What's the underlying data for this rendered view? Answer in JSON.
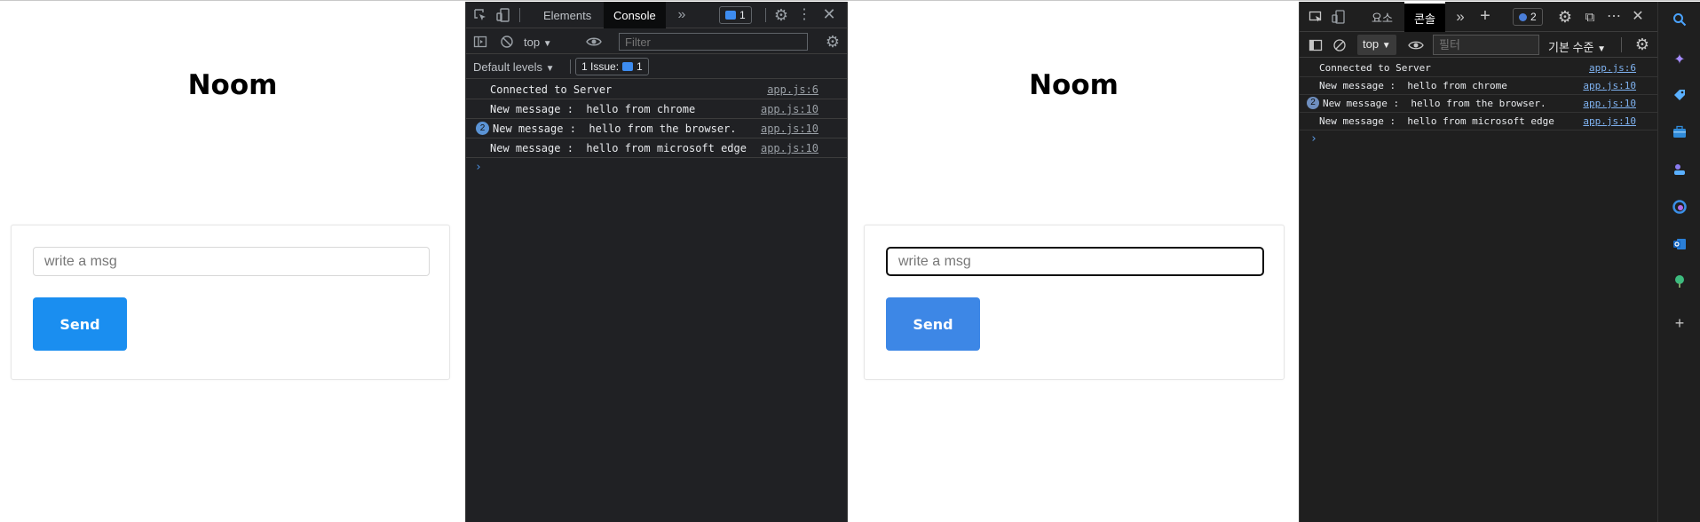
{
  "left_app": {
    "title": "Noom",
    "input_placeholder": "write a msg",
    "send_label": "Send",
    "send_color": "#1a8ef0"
  },
  "chrome_devtools": {
    "tabs": [
      "Elements",
      "Console"
    ],
    "active_tab": "Console",
    "messages_badge": "1",
    "context": "top",
    "filter_placeholder": "Filter",
    "levels": "Default levels",
    "issues": "1 Issue:",
    "issues_count": "1",
    "logs": [
      {
        "count": "",
        "text": "Connected to Server",
        "source": "app.js:6"
      },
      {
        "count": "",
        "text": "New message :  hello from chrome",
        "source": "app.js:10"
      },
      {
        "count": "2",
        "text": "New message :  hello from the browser.",
        "source": "app.js:10"
      },
      {
        "count": "",
        "text": "New message :  hello from microsoft edge",
        "source": "app.js:10"
      }
    ]
  },
  "right_app": {
    "title": "Noom",
    "input_placeholder": "write a msg",
    "send_label": "Send",
    "send_color": "#3d87e6"
  },
  "edge_devtools": {
    "tabs": [
      "요소",
      "콘솔"
    ],
    "active_tab": "콘솔",
    "issues_badge": "2",
    "context": "top",
    "filter_placeholder": "필터",
    "levels": "기본 수준",
    "logs": [
      {
        "count": "",
        "text": "Connected to Server",
        "source": "app.js:6"
      },
      {
        "count": "",
        "text": "New message :  hello from chrome",
        "source": "app.js:10"
      },
      {
        "count": "2",
        "text": "New message :  hello from the browser.",
        "source": "app.js:10"
      },
      {
        "count": "",
        "text": "New message :  hello from microsoft edge",
        "source": "app.js:10"
      }
    ]
  },
  "edge_sidebar": {
    "icons": [
      "search-icon",
      "copilot-icon",
      "tag-icon",
      "briefcase-icon",
      "games-icon",
      "edge-icon",
      "outlook-icon",
      "tree-icon",
      "add-icon"
    ]
  }
}
